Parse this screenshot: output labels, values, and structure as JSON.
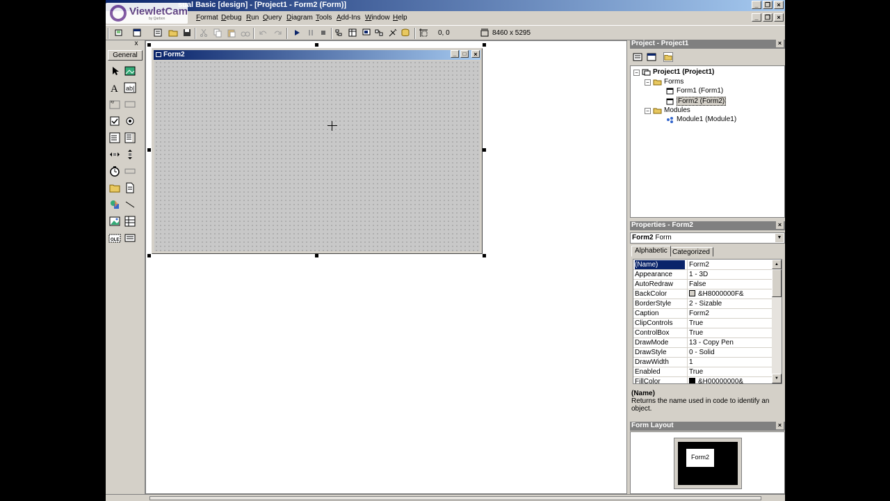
{
  "app": {
    "title": "Microsoft Visual Basic [design] - [Project1 - Form2 (Form)]",
    "title_visible": "sual Basic [design] - [Project1 - Form2 (Form)]"
  },
  "watermark": {
    "brand": "ViewletCam",
    "sub": "by Qarbon"
  },
  "menu": {
    "items": [
      "Format",
      "Debug",
      "Run",
      "Query",
      "Diagram",
      "Tools",
      "Add-Ins",
      "Window",
      "Help"
    ]
  },
  "toolbar": {
    "position": "0, 0",
    "size": "8460 x 5295"
  },
  "toolbox": {
    "tab": "General",
    "close": "x"
  },
  "form2": {
    "title": "Form2"
  },
  "project": {
    "title": "Project - Project1",
    "root": "Project1 (Project1)",
    "forms_folder": "Forms",
    "form1": "Form1 (Form1)",
    "form2": "Form2 (Form2)",
    "modules_folder": "Modules",
    "module1": "Module1 (Module1)"
  },
  "properties": {
    "title": "Properties - Form2",
    "object_name": "Form2",
    "object_type": "Form",
    "tab_alpha": "Alphabetic",
    "tab_cat": "Categorized",
    "rows": [
      {
        "name": "(Name)",
        "value": "Form2"
      },
      {
        "name": "Appearance",
        "value": "1 - 3D"
      },
      {
        "name": "AutoRedraw",
        "value": "False"
      },
      {
        "name": "BackColor",
        "value": "&H8000000F&"
      },
      {
        "name": "BorderStyle",
        "value": "2 - Sizable"
      },
      {
        "name": "Caption",
        "value": "Form2"
      },
      {
        "name": "ClipControls",
        "value": "True"
      },
      {
        "name": "ControlBox",
        "value": "True"
      },
      {
        "name": "DrawMode",
        "value": "13 - Copy Pen"
      },
      {
        "name": "DrawStyle",
        "value": "0 - Solid"
      },
      {
        "name": "DrawWidth",
        "value": "1"
      },
      {
        "name": "Enabled",
        "value": "True"
      },
      {
        "name": "FillColor",
        "value": "&H00000000&"
      }
    ],
    "desc_title": "(Name)",
    "desc_text": "Returns the name used in code to identify an object."
  },
  "form_layout": {
    "title": "Form Layout",
    "mini_form": "Form2"
  },
  "colors": {
    "titlebar_start": "#0a246a",
    "titlebar_end": "#a6caf0",
    "face": "#d4d0c8",
    "backcolor_swatch": "#d4d0c8",
    "fillcolor_swatch": "#000000"
  }
}
